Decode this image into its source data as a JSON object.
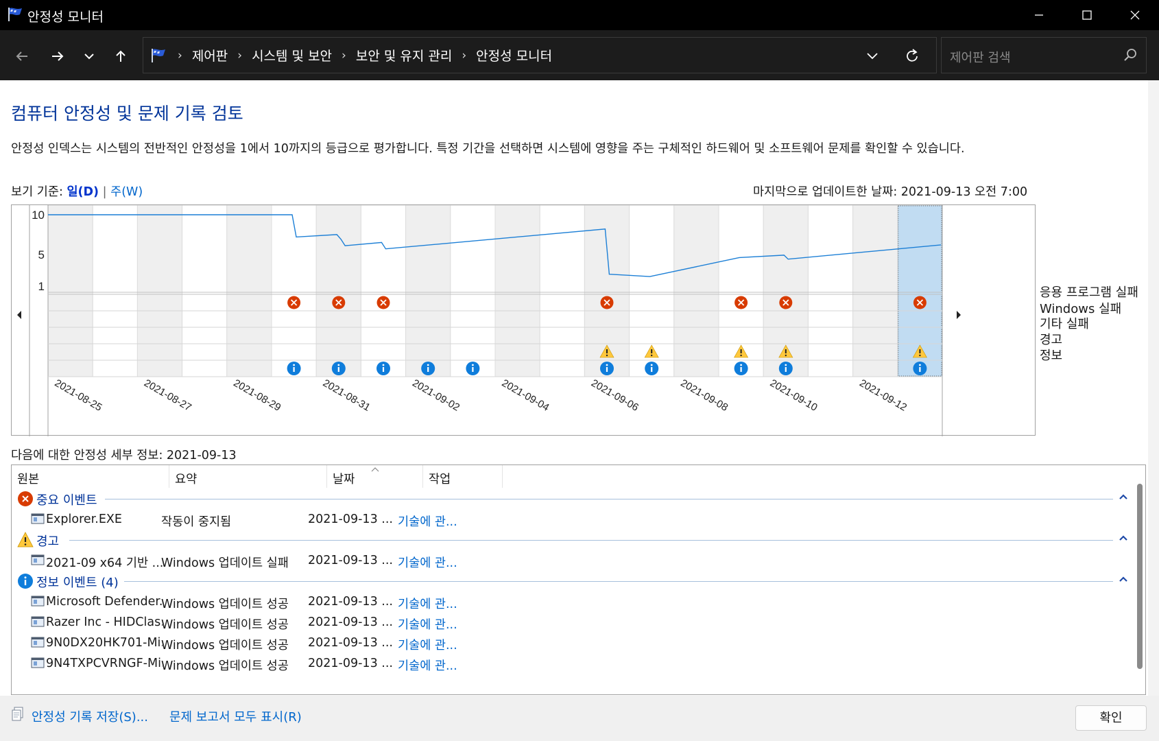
{
  "window": {
    "title": "안정성 모니터"
  },
  "nav": {
    "breadcrumbs": [
      "제어판",
      "시스템 및 보안",
      "보안 및 유지 관리",
      "안정성 모니터"
    ],
    "search_placeholder": "제어판 검색"
  },
  "header": {
    "title": "컴퓨터 안정성 및 문제 기록 검토",
    "description": "안정성 인덱스는 시스템의 전반적인 안정성을 1에서 10까지의 등급으로 평가합니다. 특정 기간을 선택하면 시스템에 영향을 주는 구체적인 하드웨어 및 소프트웨어 문제를 확인할 수 있습니다.",
    "view_by_label": "보기 기준:",
    "view_day": "일(D)",
    "view_sep": "|",
    "view_week": "주(W)",
    "last_updated": "마지막으로 업데이트한 날짜: 2021-09-13 오전 7:00"
  },
  "chart_data": {
    "type": "line",
    "y_ticks": [
      "10",
      "5",
      "1"
    ],
    "ylim": [
      1,
      10
    ],
    "dates": [
      "2021-08-25",
      "2021-08-26",
      "2021-08-27",
      "2021-08-28",
      "2021-08-29",
      "2021-08-30",
      "2021-08-31",
      "2021-09-01",
      "2021-09-02",
      "2021-09-03",
      "2021-09-04",
      "2021-09-05",
      "2021-09-06",
      "2021-09-07",
      "2021-09-08",
      "2021-09-09",
      "2021-09-10",
      "2021-09-11",
      "2021-09-12",
      "2021-09-13"
    ],
    "x_tick_labels": [
      "2021-08-25",
      "2021-08-27",
      "2021-08-29",
      "2021-08-31",
      "2021-09-02",
      "2021-09-04",
      "2021-09-06",
      "2021-09-08",
      "2021-09-10",
      "2021-09-12"
    ],
    "selected_date": "2021-09-13",
    "stability_index": [
      [
        "2021-08-25",
        10.0
      ],
      [
        "2021-08-30",
        10.0
      ],
      [
        "2021-08-30",
        7.2
      ],
      [
        "2021-08-31",
        7.5
      ],
      [
        "2021-08-31",
        6.9
      ],
      [
        "2021-08-31",
        6.1
      ],
      [
        "2021-09-01",
        6.5
      ],
      [
        "2021-09-01",
        5.7
      ],
      [
        "2021-09-06",
        8.2
      ],
      [
        "2021-09-06",
        2.5
      ],
      [
        "2021-09-07",
        2.2
      ],
      [
        "2021-09-09",
        4.6
      ],
      [
        "2021-09-10",
        4.9
      ],
      [
        "2021-09-10",
        4.4
      ],
      [
        "2021-09-13",
        6.2
      ]
    ],
    "event_rows": [
      "응용 프로그램 실패",
      "Windows 실패",
      "기타 실패",
      "경고",
      "정보"
    ],
    "events": {
      "응용 프로그램 실패": [
        "2021-08-30",
        "2021-08-31",
        "2021-09-01",
        "2021-09-06",
        "2021-09-09",
        "2021-09-10",
        "2021-09-13"
      ],
      "Windows 실패": [],
      "기타 실패": [],
      "경고": [
        "2021-09-06",
        "2021-09-07",
        "2021-09-09",
        "2021-09-10",
        "2021-09-13"
      ],
      "정보": [
        "2021-08-30",
        "2021-08-31",
        "2021-09-01",
        "2021-09-02",
        "2021-09-03",
        "2021-09-06",
        "2021-09-07",
        "2021-09-09",
        "2021-09-10",
        "2021-09-13"
      ]
    },
    "colors": {
      "line": "#1c7fd6",
      "error": "#d83b01",
      "warning": "#ffc83d",
      "info": "#0f7ddb",
      "selected": "#c1dcf2"
    }
  },
  "details": {
    "label": "다음에 대한 안정성 세부 정보: 2021-09-13",
    "columns": [
      "원본",
      "요약",
      "날짜",
      "작업"
    ],
    "groups": [
      {
        "icon": "error-icon",
        "title": "중요 이벤트",
        "rows": [
          {
            "source": "Explorer.EXE",
            "summary": "작동이 중지됨",
            "date": "2021-09-13 ...",
            "action": "기술에 관..."
          }
        ]
      },
      {
        "icon": "warning-icon",
        "title": "경고",
        "rows": [
          {
            "source": "2021-09 x64 기반 ...",
            "summary": "Windows 업데이트 실패",
            "date": "2021-09-13 ...",
            "action": "기술에 관..."
          }
        ]
      },
      {
        "icon": "info-icon",
        "title": "정보 이벤트 (4)",
        "rows": [
          {
            "source": "Microsoft Defender...",
            "summary": "Windows 업데이트 성공",
            "date": "2021-09-13 ...",
            "action": "기술에 관..."
          },
          {
            "source": "Razer Inc - HIDClas...",
            "summary": "Windows 업데이트 성공",
            "date": "2021-09-13 ...",
            "action": "기술에 관..."
          },
          {
            "source": "9N0DX20HK701-Mi...",
            "summary": "Windows 업데이트 성공",
            "date": "2021-09-13 ...",
            "action": "기술에 관..."
          },
          {
            "source": "9N4TXPCVRNGF-Mi...",
            "summary": "Windows 업데이트 성공",
            "date": "2021-09-13 ...",
            "action": "기술에 관..."
          }
        ]
      }
    ]
  },
  "footer": {
    "save_link": "안정성 기록 저장(S)...",
    "reports_link": "문제 보고서 모두 표시(R)",
    "ok_button": "확인"
  }
}
